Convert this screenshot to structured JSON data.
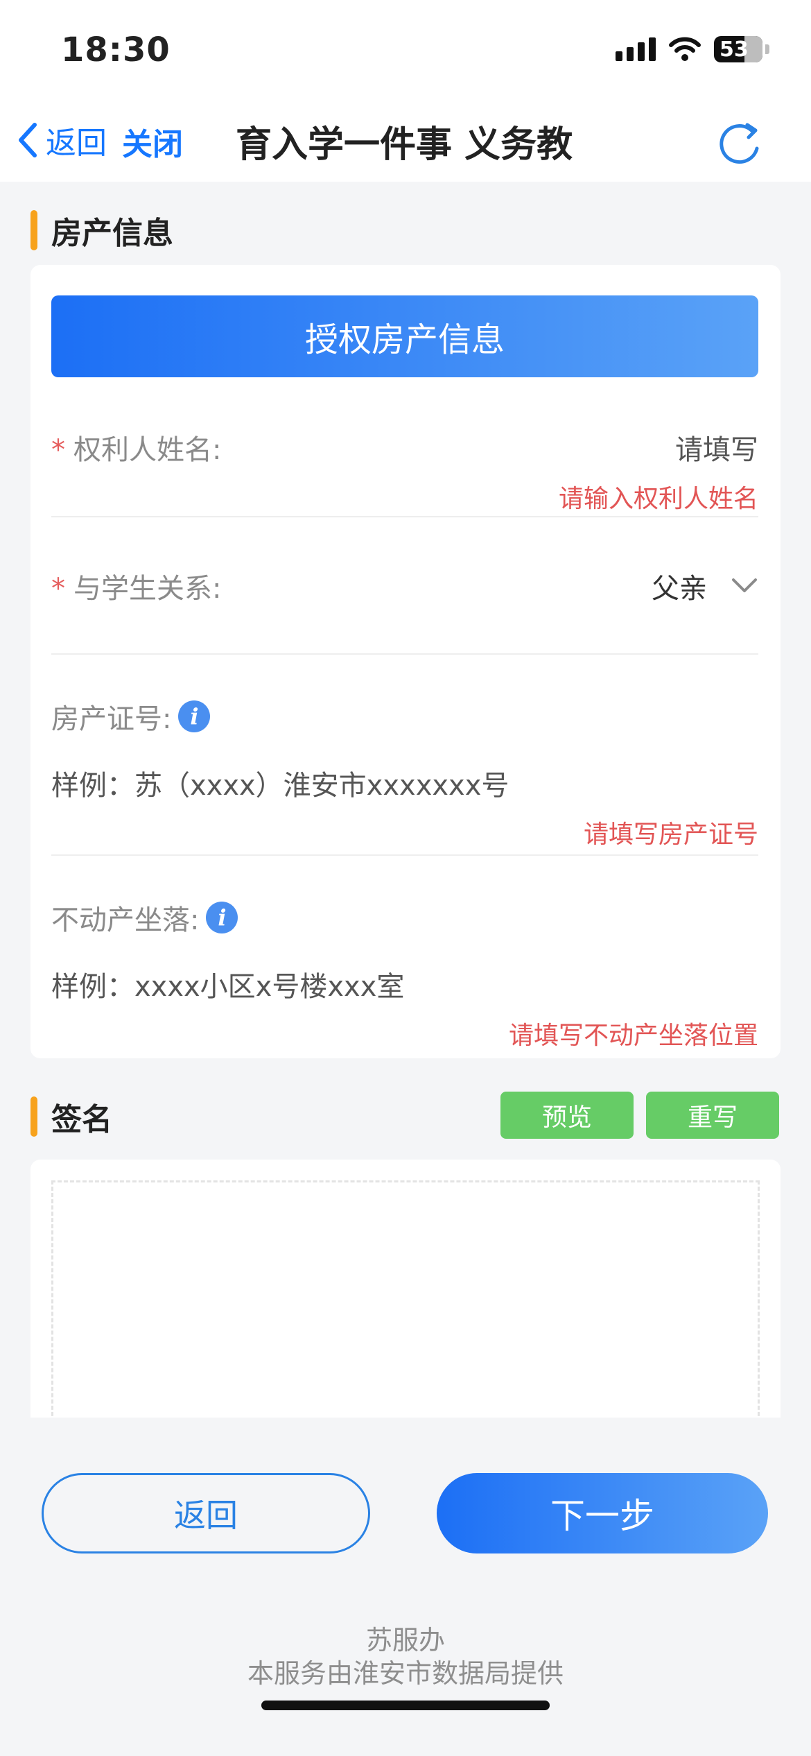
{
  "status_bar": {
    "time": "18:30",
    "battery": "53"
  },
  "nav": {
    "back_label": "返回",
    "close_label": "关闭",
    "title": "育入学一件事  义务教"
  },
  "property_section": {
    "title": "房产信息",
    "authorize_button": "授权房产信息",
    "owner_name": {
      "label": "权利人姓名:",
      "placeholder": "请填写",
      "error": "请输入权利人姓名"
    },
    "relation": {
      "label": "与学生关系:",
      "value": "父亲"
    },
    "certificate": {
      "label": "房产证号:",
      "placeholder": "样例：苏（xxxx）淮安市xxxxxxx号",
      "error": "请填写房产证号"
    },
    "location": {
      "label": "不动产坐落:",
      "placeholder": "样例：xxxx小区x号楼xxx室",
      "error": "请填写不动产坐落位置"
    }
  },
  "signature_section": {
    "title": "签名",
    "preview_button": "预览",
    "rewrite_button": "重写"
  },
  "bottom": {
    "back_button": "返回",
    "next_button": "下一步",
    "footer_line1": "苏服办",
    "footer_line2": "本服务由淮安市数据局提供"
  }
}
